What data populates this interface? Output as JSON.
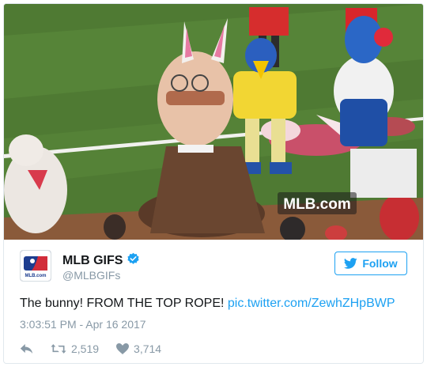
{
  "media": {
    "watermark": "MLB.com",
    "colors": {
      "grass": "#4f7a33",
      "grass_light": "#5c8a3c",
      "foul_line": "#f1f1ee"
    }
  },
  "account": {
    "avatar_label": "MLB.com",
    "display_name": "MLB GIFS",
    "handle": "@MLBGIFs",
    "verified_icon": "verified-badge-icon"
  },
  "follow_button": {
    "label": "Follow",
    "icon": "twitter-bird-icon"
  },
  "tweet": {
    "text": "The bunny! FROM THE TOP ROPE! ",
    "link": "pic.twitter.com/ZewhZHpBWP",
    "timestamp": "3:03:51 PM - Apr 16 2017"
  },
  "actions": {
    "reply_icon": "reply-icon",
    "retweet_icon": "retweet-icon",
    "retweet_count": "2,519",
    "like_icon": "heart-icon",
    "like_count": "3,714"
  },
  "colors": {
    "accent": "#1da1f2",
    "text": "#14171a",
    "muted": "#8899a6",
    "border": "#e1e8ed"
  }
}
